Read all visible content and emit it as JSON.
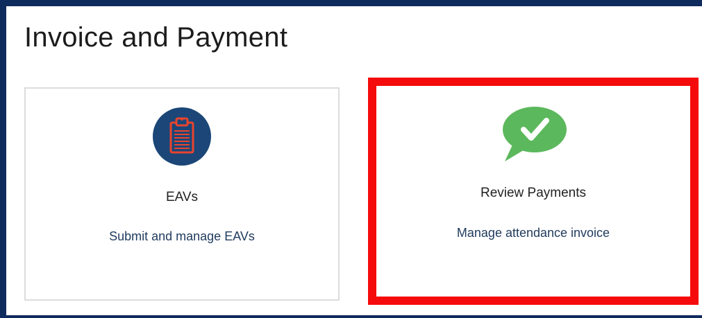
{
  "page": {
    "title": "Invoice and Payment"
  },
  "cards": [
    {
      "title": "EAVs",
      "description": "Submit and manage EAVs",
      "icon": "clipboard-icon"
    },
    {
      "title": "Review Payments",
      "description": "Manage attendance invoice",
      "icon": "checkmark-chat-bubble-icon",
      "highlighted": true
    }
  ],
  "colors": {
    "frame_border": "#0f2a5c",
    "eavs_icon_bg": "#1b4677",
    "eavs_icon_clipboard": "#e8442e",
    "review_icon_bubble": "#5cb85c",
    "highlight_outline": "#f50b0b",
    "card_description": "#1f3a5c"
  }
}
